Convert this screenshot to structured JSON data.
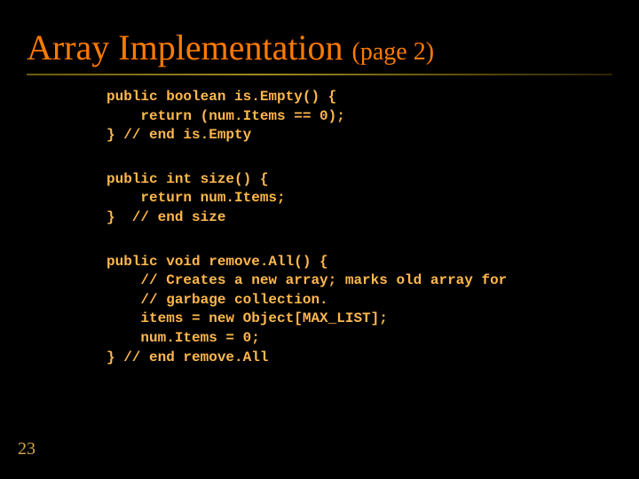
{
  "title": {
    "main": "Array Implementation",
    "sub": "(page 2)"
  },
  "code": {
    "block1": "public boolean is.Empty() {\n    return (num.Items == 0);\n} // end is.Empty",
    "block2": "public int size() {\n    return num.Items;\n}  // end size",
    "block3": "public void remove.All() {\n    // Creates a new array; marks old array for\n    // garbage collection.\n    items = new Object[MAX_LIST];\n    num.Items = 0;\n} // end remove.All"
  },
  "page_number": "23"
}
